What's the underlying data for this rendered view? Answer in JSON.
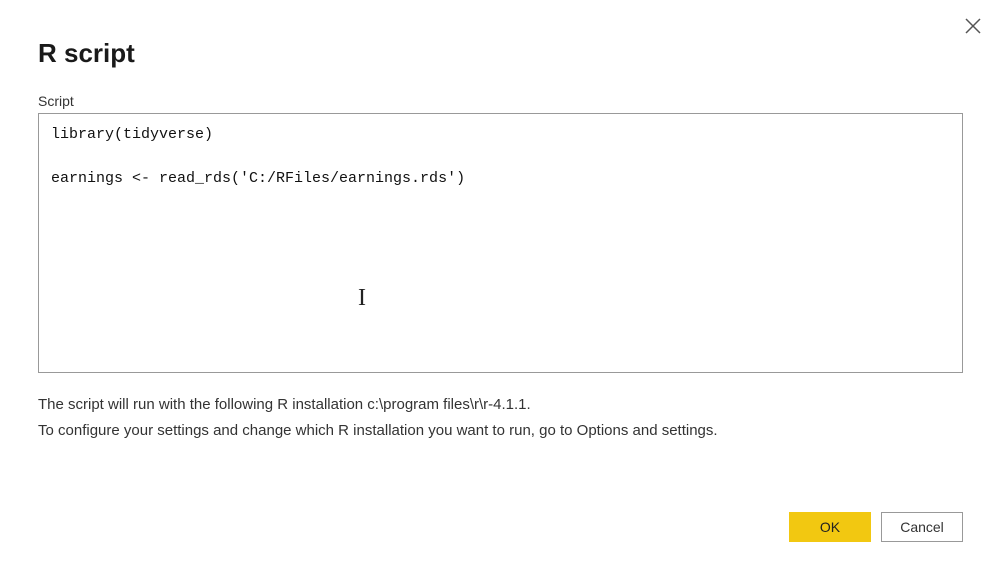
{
  "dialog": {
    "title": "R script",
    "close_icon": "×"
  },
  "script": {
    "label": "Script",
    "content": "library(tidyverse)\n\nearnings <- read_rds('C:/RFiles/earnings.rds')"
  },
  "info": {
    "line1": "The script will run with the following R installation c:\\program files\\r\\r-4.1.1.",
    "line2": "To configure your settings and change which R installation you want to run, go to Options and settings."
  },
  "buttons": {
    "ok": "OK",
    "cancel": "Cancel"
  },
  "colors": {
    "primary": "#F2C811",
    "border": "#999999",
    "text": "#333333"
  }
}
